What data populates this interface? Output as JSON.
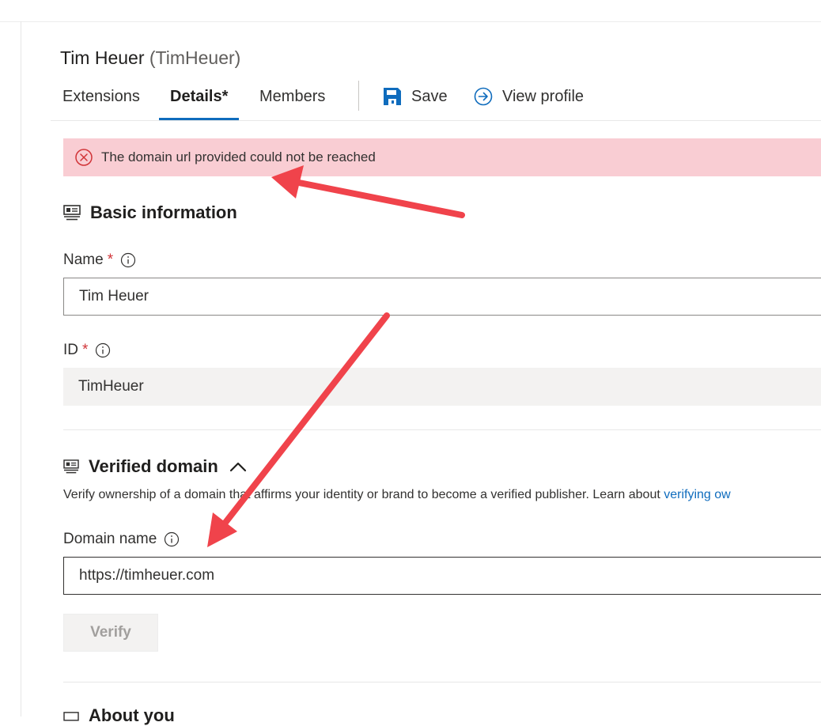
{
  "header": {
    "name": "Tim Heuer",
    "handle": "(TimHeuer)"
  },
  "tabs": [
    {
      "label": "Extensions",
      "active": false
    },
    {
      "label": "Details*",
      "active": true
    },
    {
      "label": "Members",
      "active": false
    }
  ],
  "commands": {
    "save_label": "Save",
    "view_profile_label": "View profile"
  },
  "error": {
    "message": "The domain url provided could not be reached"
  },
  "basic_info": {
    "heading": "Basic information",
    "name_label": "Name",
    "name_value": "Tim Heuer",
    "id_label": "ID",
    "id_value": "TimHeuer",
    "required_marker": "*"
  },
  "verified_domain": {
    "heading": "Verified domain",
    "description": "Verify ownership of a domain that affirms your identity or brand to become a verified publisher. Learn about ",
    "link_text": "verifying ow",
    "domain_label": "Domain name",
    "domain_value": "https://timheuer.com",
    "verify_label": "Verify"
  },
  "next_section": {
    "heading": "About you"
  },
  "colors": {
    "accent": "#0f6cbd",
    "error_bg": "#f9cdd3",
    "error_icon": "#d13438",
    "annotation_arrow": "#f0434b"
  }
}
